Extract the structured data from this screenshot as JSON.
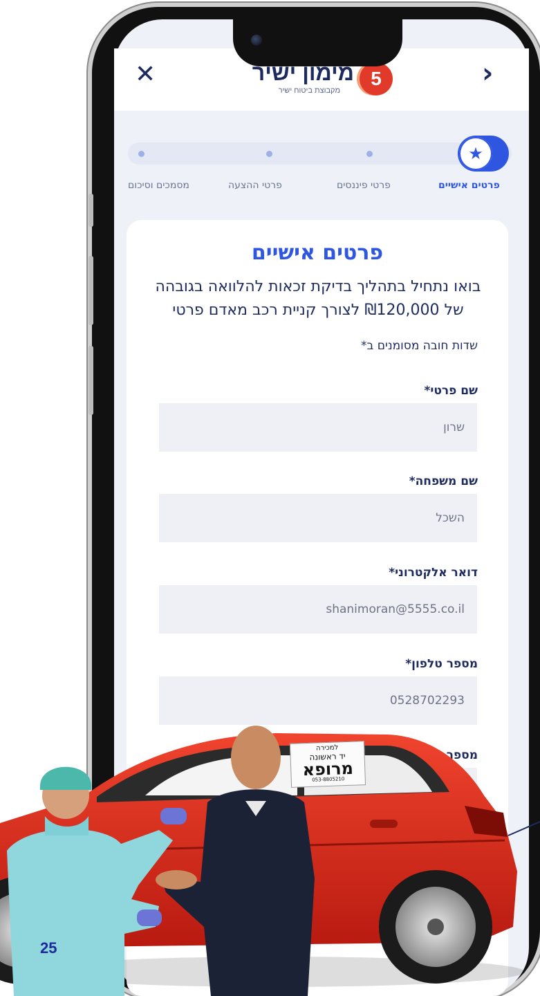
{
  "header": {
    "close_icon": "close-icon",
    "back_icon": "chevron-right-icon",
    "logo": {
      "number": "5",
      "name": "מימון ישיר",
      "subtitle": "מקבוצת ביטוח ישיר"
    }
  },
  "steps": [
    {
      "label": "פרטים אישיים",
      "active": true,
      "icon": "star-icon"
    },
    {
      "label": "פרטי פיננסים",
      "active": false
    },
    {
      "label": "פרטי ההצעה",
      "active": false
    },
    {
      "label": "מסמכים וסיכום",
      "active": false
    }
  ],
  "form": {
    "title": "פרטים אישיים",
    "intro": "בואו נתחיל בתהליך בדיקת זכאות להלוואה בגובהה של ₪120,000 לצורך קניית רכב מאדם פרטי",
    "required_note": "שדות חובה מסומנים ב*",
    "fields": [
      {
        "label": "שם פרטי*",
        "value": "שרון"
      },
      {
        "label": "שם משפחה*",
        "value": "השכל"
      },
      {
        "label": "דואר אלקטרוני*",
        "value": "shanimoran@5555.co.il"
      },
      {
        "label": "מספר טלפון*",
        "value": "0528702293"
      },
      {
        "label": "מספר טל"
      }
    ]
  },
  "overlay": {
    "page_number": "25",
    "car_sign": {
      "line1": "למכירה",
      "line2": "יד ראשונה",
      "line3": "מרופא",
      "line4": "053-8805210"
    },
    "colors": {
      "car": "#d92a1c",
      "brand_blue": "#2f56e1",
      "navy": "#1c2a5e"
    }
  }
}
